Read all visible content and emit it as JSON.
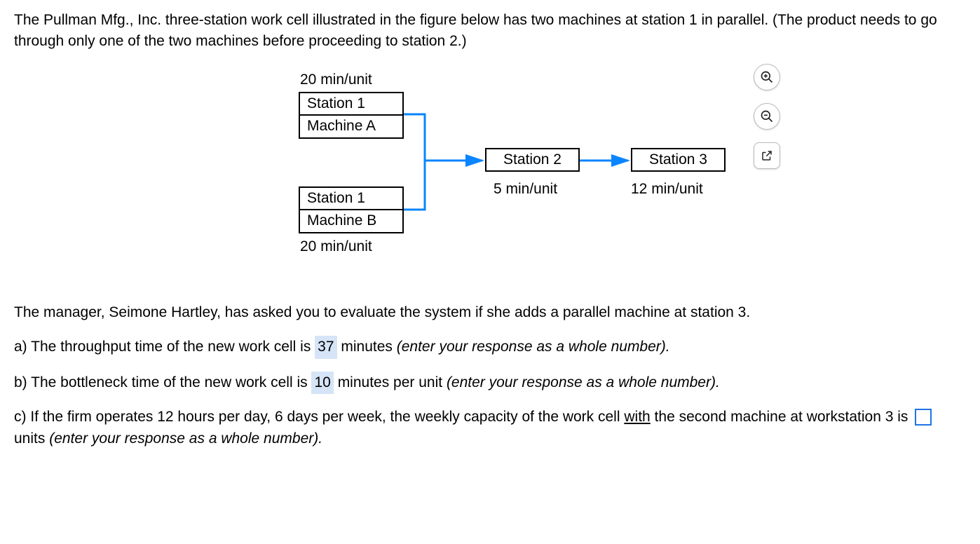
{
  "intro": "The Pullman Mfg., Inc. three-station work cell illustrated in the figure below has two machines at station 1 in parallel. (The product needs to go through only one of the two machines before proceeding to station 2.)",
  "diagram": {
    "station1a_time": "20 min/unit",
    "station1a_line1": "Station 1",
    "station1a_line2": "Machine A",
    "station1b_time": "20 min/unit",
    "station1b_line1": "Station 1",
    "station1b_line2": "Machine B",
    "station2_label": "Station 2",
    "station2_time": "5 min/unit",
    "station3_label": "Station 3",
    "station3_time": "12 min/unit"
  },
  "icons": {
    "zoom_in": "zoom-in-icon",
    "zoom_out": "zoom-out-icon",
    "popout": "popout-icon"
  },
  "manager_text": "The manager, Seimone Hartley, has asked you to evaluate the system if she adds a parallel machine at station 3.",
  "qa": {
    "a_pre": "a) The throughput time of the new work cell is ",
    "a_val": "37",
    "a_post1": " minutes ",
    "a_post2": "(enter your response as a whole number).",
    "b_pre": "b) The bottleneck time of the new work cell is ",
    "b_val": "10",
    "b_post1": " minutes per unit ",
    "b_post2": "(enter your response as a whole number).",
    "c_pre1": "c) If the firm operates 12 hours per day, 6 days per week, the weekly capacity of the work cell ",
    "c_with": "with",
    "c_pre2": " the second machine at workstation 3 is ",
    "c_post1": " units ",
    "c_post2": "(enter your response as a whole number)."
  }
}
